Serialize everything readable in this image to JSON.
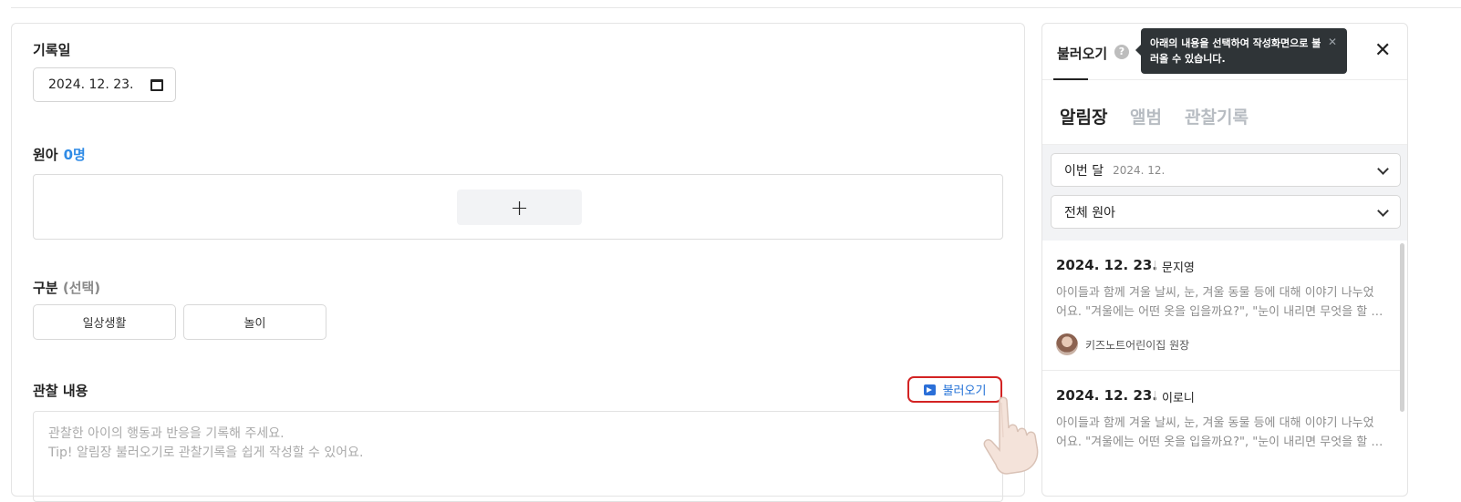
{
  "form": {
    "record_date_label": "기록일",
    "record_date_value": "2024. 12. 23.",
    "kids_label": "원아",
    "kids_count": "0명",
    "add_symbol": "+",
    "category_label": "구분",
    "category_hint": "(선택)",
    "categories": [
      "일상생활",
      "놀이"
    ],
    "content_label": "관찰 내용",
    "load_button": "불러오기",
    "content_placeholder_line1": "관찰한 아이의 행동과 반응을 기록해 주세요.",
    "content_placeholder_line2": "Tip! 알림장 불러오기로 관찰기록을 쉽게 작성할 수 있어요."
  },
  "panel": {
    "title": "불러오기",
    "help_symbol": "?",
    "close_symbol": "✕",
    "tooltip_text": "아래의 내용을 선택하여 작성화면으로 불러올 수 있습니다.",
    "tooltip_close": "✕",
    "tabs": [
      "알림장",
      "앨범",
      "관찰기록"
    ],
    "period_label": "이번 달",
    "period_value": "2024. 12.",
    "kid_filter": "전체 원아",
    "cards": [
      {
        "date": "2024. 12. 23.",
        "name": "문지영",
        "text": "아이들과 함께 겨울 날씨, 눈, 겨울 동물 등에 대해 이야기 나누었어요. \"겨울에는 어떤 옷을 입을까요?\", \"눈이 내리면 무엇을 할 수 있을까요?\"",
        "author": "키즈노트어린이집 원장"
      },
      {
        "date": "2024. 12. 23.",
        "name": "이로니",
        "text": "아이들과 함께 겨울 날씨, 눈, 겨울 동물 등에 대해 이야기 나누었어요. \"겨울에는 어떤 옷을 입을까요?\", \"눈이 내리면 무엇을 할 수 있을까요?\""
      }
    ]
  },
  "colors": {
    "accent_blue": "#2f8be6",
    "highlight_red": "#d32323",
    "tooltip_bg": "#2f3437"
  }
}
